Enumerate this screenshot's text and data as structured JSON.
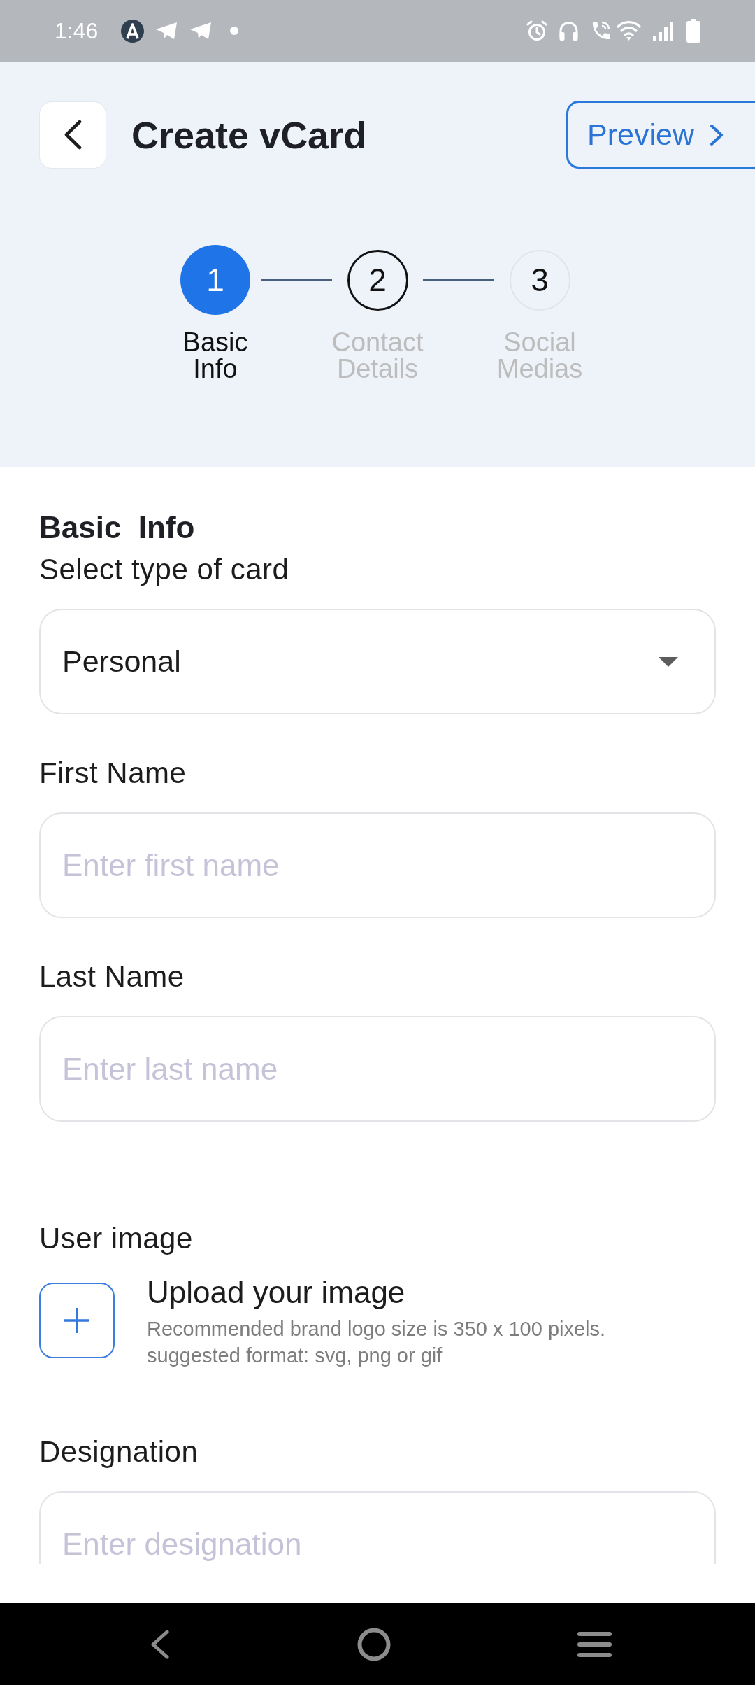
{
  "status_bar": {
    "time": "1:46"
  },
  "header": {
    "title": "Create vCard",
    "preview_button": "Preview"
  },
  "stepper": [
    {
      "number": "1",
      "label": "Basic Info",
      "selected": true,
      "highlighted": false
    },
    {
      "number": "2",
      "label": "Contact Details",
      "selected": false,
      "highlighted": true
    },
    {
      "number": "3",
      "label": "Social Medias",
      "selected": false,
      "highlighted": false
    }
  ],
  "form": {
    "title": "Basic  Info",
    "fields": [
      {
        "kind": "select",
        "label": "Select type of card",
        "value": "Personal"
      },
      {
        "kind": "text",
        "label": "First Name",
        "placeholder": "Enter first name"
      },
      {
        "kind": "text",
        "label": "Last Name",
        "placeholder": "Enter last name"
      },
      {
        "kind": "upload",
        "label": "User image",
        "title": "Upload your image",
        "hint": [
          "Recommended brand logo size is 350 x 100 pixels.",
          "suggested format: svg, png or gif"
        ]
      },
      {
        "kind": "text",
        "label": "Designation",
        "placeholder": "Enter designation"
      }
    ]
  }
}
